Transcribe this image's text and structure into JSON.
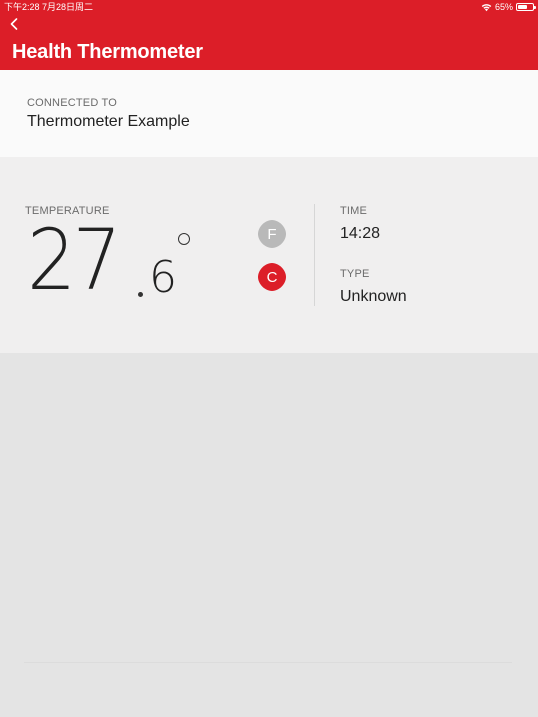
{
  "status_bar": {
    "time_date": "下午2:28   7月28日周二",
    "battery": "65%",
    "battery_level": 0.65
  },
  "header": {
    "title": "Health Thermometer",
    "back_icon": "chevron-left-icon",
    "background": "#dc1e28"
  },
  "connection": {
    "label": "CONNECTED TO",
    "device": "Thermometer Example"
  },
  "reading": {
    "label": "TEMPERATURE",
    "value_integer": "27",
    "value_decimal": "6",
    "units": [
      {
        "label": "F",
        "selected": false,
        "color": "#b9b9b9"
      },
      {
        "label": "C",
        "selected": true,
        "color": "#dc1e28"
      }
    ]
  },
  "info": {
    "time_label": "TIME",
    "time_value": "14:28",
    "type_label": "TYPE",
    "type_value": "Unknown"
  }
}
